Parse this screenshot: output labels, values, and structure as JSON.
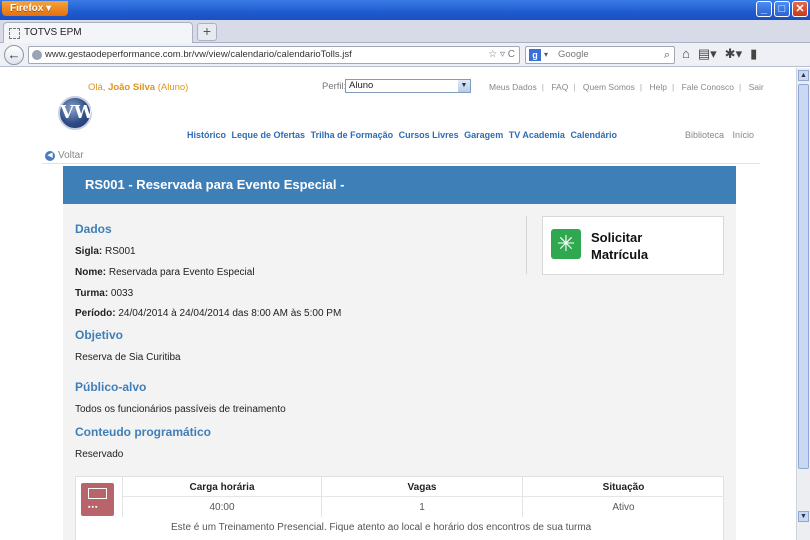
{
  "browser": {
    "menu_label": "Firefox",
    "tab_title": "TOTVS EPM",
    "new_tab_label": "+",
    "url": "www.gestaodeperformance.com.br/vw/view/calendario/calendarioTolls.jsf",
    "search_engine": "Google",
    "search_placeholder": "Google"
  },
  "header": {
    "greeting_prefix": "Olá, ",
    "user_name": "João Silva",
    "user_role": " (Aluno)",
    "logo_text": "VW",
    "perfil_label": "Perfil:",
    "perfil_value": "Aluno",
    "top_links": [
      "Meus Dados",
      "FAQ",
      "Quem Somos",
      "Help",
      "Fale Conosco",
      "Sair"
    ],
    "main_nav": [
      "Histórico",
      "Leque de Ofertas",
      "Trilha de Formação",
      "Cursos Livres",
      "Garagem",
      "TV Academia",
      "Calendário"
    ],
    "right_nav": [
      "Biblioteca",
      "Início"
    ]
  },
  "voltar_label": "Voltar",
  "course": {
    "title": "RS001 - Reservada para Evento Especial -",
    "dados_title": "Dados",
    "sigla_label": "Sigla:",
    "sigla_value": " RS001",
    "nome_label": "Nome:",
    "nome_value": " Reservada para Evento Especial",
    "turma_label": "Turma:",
    "turma_value": " 0033",
    "periodo_label": "Período:",
    "periodo_value": " 24/04/2014 à 24/04/2014 das 8:00 AM às 5:00 PM",
    "objetivo_title": "Objetivo",
    "objetivo_value": "Reserva de Sia Curitiba",
    "publico_title": "Público-alvo",
    "publico_value": "Todos os funcionários passíveis de treinamento",
    "conteudo_title": "Conteudo programático",
    "conteudo_value": "Reservado",
    "solicitar_line1": "Solicitar",
    "solicitar_line2": "Matrícula",
    "info": {
      "carga_label": "Carga horária",
      "carga_value": "40:00",
      "vagas_label": "Vagas",
      "vagas_value": "1",
      "situacao_label": "Situação",
      "situacao_value": "Ativo",
      "note": "Este é um Treinamento Presencial. Fique atento ao local e horário dos encontros de sua turma"
    }
  }
}
